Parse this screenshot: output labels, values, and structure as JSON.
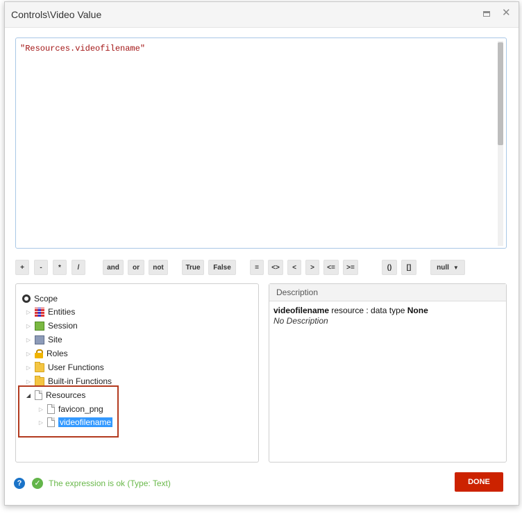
{
  "window": {
    "title": "Controls\\Video Value"
  },
  "editor": {
    "expression": "\"Resources.videofilename\""
  },
  "toolbar": {
    "ops": [
      "+",
      "-",
      "*",
      "/",
      "and",
      "or",
      "not",
      "True",
      "False",
      "=",
      "<>",
      "<",
      ">",
      "<=",
      ">=",
      "()",
      "[]"
    ],
    "null_label": "null"
  },
  "scope_tree": {
    "root": "Scope",
    "items": [
      "Entities",
      "Session",
      "Site",
      "Roles",
      "User Functions",
      "Built-in Functions",
      "Resources"
    ],
    "resources_children": [
      "favicon_png",
      "videofilename"
    ]
  },
  "description": {
    "header": "Description",
    "name": "videofilename",
    "middle": " resource : data type ",
    "type": "None",
    "text": "No Description"
  },
  "status": {
    "message": "The expression is ok (Type: Text)"
  },
  "footer": {
    "done_label": "DONE"
  },
  "colors": {
    "accent": "#cc2200",
    "ok": "#69b84a",
    "selection": "#3399ff",
    "help": "#1a73c8"
  }
}
